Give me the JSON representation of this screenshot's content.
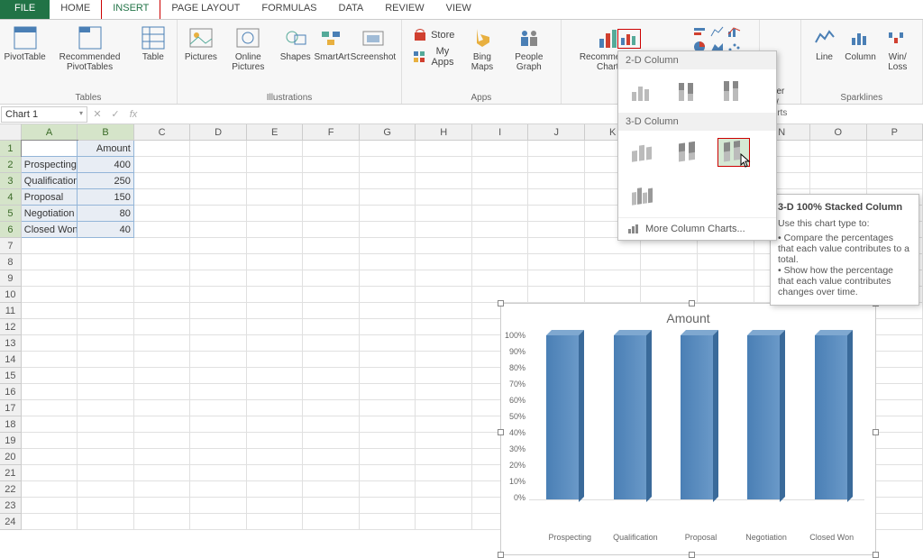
{
  "ribbon": {
    "tabs": [
      "FILE",
      "HOME",
      "INSERT",
      "PAGE LAYOUT",
      "FORMULAS",
      "DATA",
      "REVIEW",
      "VIEW"
    ],
    "active_tab": "INSERT",
    "groups": {
      "tables": {
        "label": "Tables",
        "pivot": "PivotTable",
        "rec": "Recommended PivotTables",
        "table": "Table"
      },
      "illus": {
        "label": "Illustrations",
        "pictures": "Pictures",
        "online": "Online Pictures",
        "shapes": "Shapes",
        "smartart": "SmartArt",
        "screenshot": "Screenshot"
      },
      "apps": {
        "label": "Apps",
        "store": "Store",
        "myapps": "My Apps",
        "bing": "Bing Maps",
        "people": "People Graph"
      },
      "charts": {
        "label": "Charts",
        "rec": "Recommended Charts",
        "ower": "ower iew",
        "orts": "orts"
      },
      "sparklines": {
        "label": "Sparklines",
        "line": "Line",
        "column": "Column",
        "winloss": "Win/ Loss"
      }
    }
  },
  "namebox": "Chart 1",
  "columns": [
    "A",
    "B",
    "C",
    "D",
    "E",
    "F",
    "G",
    "H",
    "I",
    "J",
    "K",
    "L",
    "M",
    "N",
    "O",
    "P"
  ],
  "data": {
    "A1": " ",
    "B1": "Amount",
    "A2": "Prospecting",
    "B2": "400",
    "A3": "Qualification",
    "B3": "250",
    "A4": "Proposal",
    "B4": "150",
    "A5": "Negotiation",
    "B5": "80",
    "A6": "Closed Won",
    "B6": "40"
  },
  "dropdown": {
    "h1": "2-D Column",
    "h2": "3-D Column",
    "more": "More Column Charts..."
  },
  "tooltip": {
    "title": "3-D 100% Stacked Column",
    "lead": "Use this chart type to:",
    "b1": "Compare the percentages that each value contributes to a total.",
    "b2": "Show how the percentage that each value contributes changes over time."
  },
  "chart_data": {
    "type": "bar",
    "title": "Amount",
    "categories": [
      "Prospecting",
      "Qualification",
      "Proposal",
      "Negotiation",
      "Closed Won"
    ],
    "values": [
      100,
      100,
      100,
      100,
      100
    ],
    "y_ticks": [
      "100%",
      "90%",
      "80%",
      "70%",
      "60%",
      "50%",
      "40%",
      "30%",
      "20%",
      "10%",
      "0%"
    ],
    "ylim": [
      0,
      100
    ]
  }
}
